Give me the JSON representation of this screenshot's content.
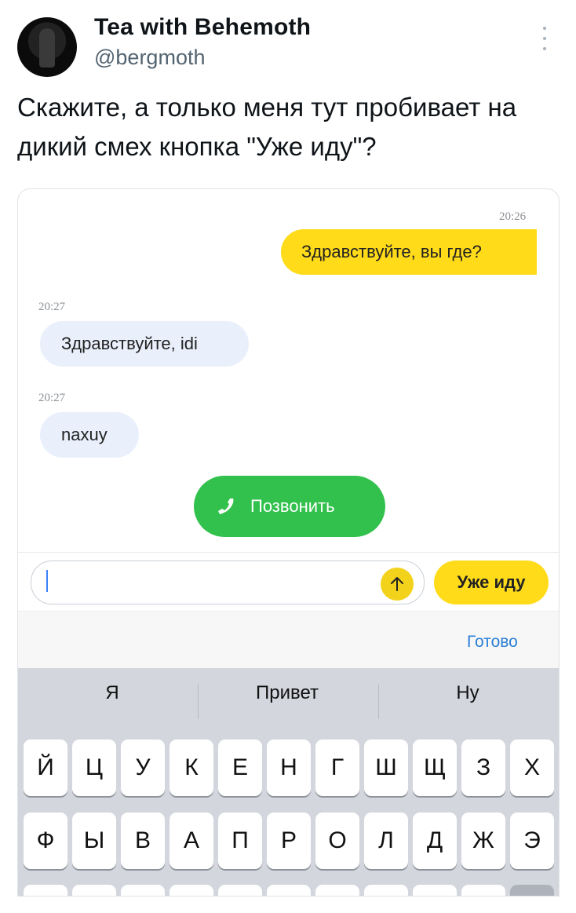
{
  "tweet": {
    "display_name": "Tea with Behemoth",
    "handle": "@bergmoth",
    "text": "Скажите, а только меня тут пробивает на дикий смех кнопка \"Уже иду\"?"
  },
  "chat": {
    "messages": [
      {
        "direction": "outgoing",
        "time": "20:26",
        "text": "Здравствуйте, вы где?"
      },
      {
        "direction": "incoming",
        "time": "20:27",
        "text": "Здравствуйте, idi"
      },
      {
        "direction": "incoming",
        "time": "20:27",
        "text": "naxuy"
      }
    ],
    "call_button_label": "Позвонить",
    "input_value": "",
    "quick_reply_label": "Уже иду",
    "done_label": "Готово"
  },
  "keyboard": {
    "suggestions": [
      "Я",
      "Привет",
      "Ну"
    ],
    "row1": [
      "Й",
      "Ц",
      "У",
      "К",
      "Е",
      "Н",
      "Г",
      "Ш",
      "Щ",
      "З",
      "Х"
    ],
    "row2": [
      "Ф",
      "Ы",
      "В",
      "А",
      "П",
      "Р",
      "О",
      "Л",
      "Д",
      "Ж",
      "Э"
    ]
  },
  "colors": {
    "accent_yellow": "#ffdb1a",
    "call_green": "#31c14c",
    "incoming_bubble": "#e9f0fb",
    "link_blue": "#2b7fd6"
  },
  "icons": [
    "more-vertical-icon",
    "phone-icon",
    "arrow-up-icon"
  ]
}
